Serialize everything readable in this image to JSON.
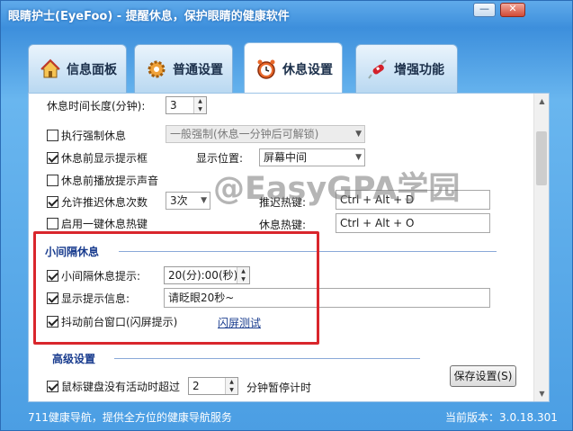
{
  "window": {
    "title": "眼睛护士(EyeFoo) - 提醒休息，保护眼睛的健康软件",
    "minimize_glyph": "—",
    "close_glyph": "✕"
  },
  "tabs": [
    {
      "label": "信息面板",
      "icon": "house-icon"
    },
    {
      "label": "普通设置",
      "icon": "gear-icon"
    },
    {
      "label": "休息设置",
      "icon": "clock-icon",
      "active": true
    },
    {
      "label": "增强功能",
      "icon": "swiss-knife-icon"
    }
  ],
  "rest_settings": {
    "rest_duration_label": "休息时间长度(分钟):",
    "rest_duration_value": "3",
    "force_rest_label": "执行强制休息",
    "force_rest_checked": false,
    "force_mode_value": "一般强制(休息一分钟后可解锁)",
    "show_prompt_before_label": "休息前显示提示框",
    "show_prompt_before_checked": true,
    "display_position_label": "显示位置:",
    "display_position_value": "屏幕中间",
    "play_sound_label": "休息前播放提示声音",
    "play_sound_checked": false,
    "allow_delay_label": "允许推迟休息次数",
    "allow_delay_checked": true,
    "delay_count_value": "3次",
    "delay_hotkey_label": "推迟热键:",
    "delay_hotkey_value": "Ctrl + Alt + D",
    "one_key_rest_label": "启用一键休息热键",
    "one_key_rest_checked": false,
    "rest_hotkey_label": "休息热键:",
    "rest_hotkey_value": "Ctrl + Alt + O"
  },
  "short_break": {
    "section_title": "小间隔休息",
    "interval_label": "小间隔休息提示:",
    "interval_checked": true,
    "interval_value": "20(分):00(秒)",
    "show_message_label": "显示提示信息:",
    "show_message_checked": true,
    "message_value": "请眨眼20秒~",
    "shake_window_label": "抖动前台窗口(闪屏提示)",
    "shake_window_checked": true,
    "flash_test_link": "闪屏测试"
  },
  "advanced": {
    "section_title": "高级设置",
    "idle_pause_label_prefix": "鼠标键盘没有活动时超过",
    "idle_pause_checked": true,
    "idle_minutes_value": "2",
    "idle_pause_label_suffix": "分钟暂停计时",
    "save_button_label": "保存设置(S)"
  },
  "watermark": "@EasyGPA学园",
  "status": {
    "left_text": "711健康导航，提供全方位的健康导航服务",
    "version_text": "当前版本：3.0.18.301"
  },
  "colors": {
    "window_blue": "#4b9ee3",
    "highlight_red": "#d9262c",
    "section_blue": "#1a3d8f"
  }
}
